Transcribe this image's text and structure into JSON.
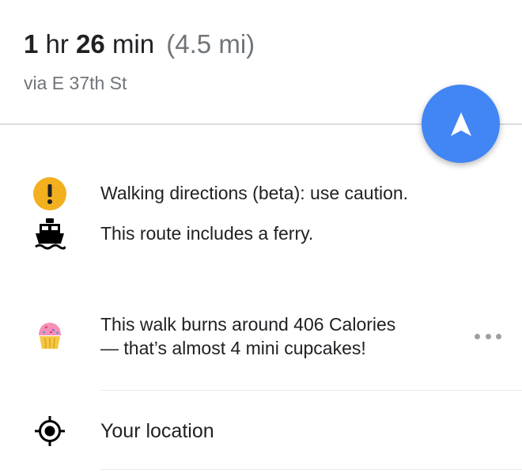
{
  "trip": {
    "hours": "1",
    "hours_unit": "hr",
    "minutes": "26",
    "minutes_unit": "min",
    "distance": "(4.5 mi)",
    "via": "via E 37th St"
  },
  "navigate_button": {
    "icon": "navigation-arrow-icon"
  },
  "notices": {
    "warning": {
      "icon": "caution-icon",
      "text": "Walking directions (beta): use caution."
    },
    "ferry": {
      "icon": "ferry-icon",
      "text": "This route includes a ferry."
    },
    "calories": {
      "icon": "cupcake-icon",
      "line1": "This walk burns around 406 Calories",
      "line2": "— that’s almost 4 mini cupcakes!",
      "more_icon": "more-horizontal-icon"
    }
  },
  "steps": {
    "start": {
      "icon": "my-location-icon",
      "label": "Your location"
    }
  },
  "colors": {
    "accent": "#4285f4",
    "warning": "#f2b01e",
    "secondary_text": "#70757a",
    "primary_text": "#202124"
  }
}
